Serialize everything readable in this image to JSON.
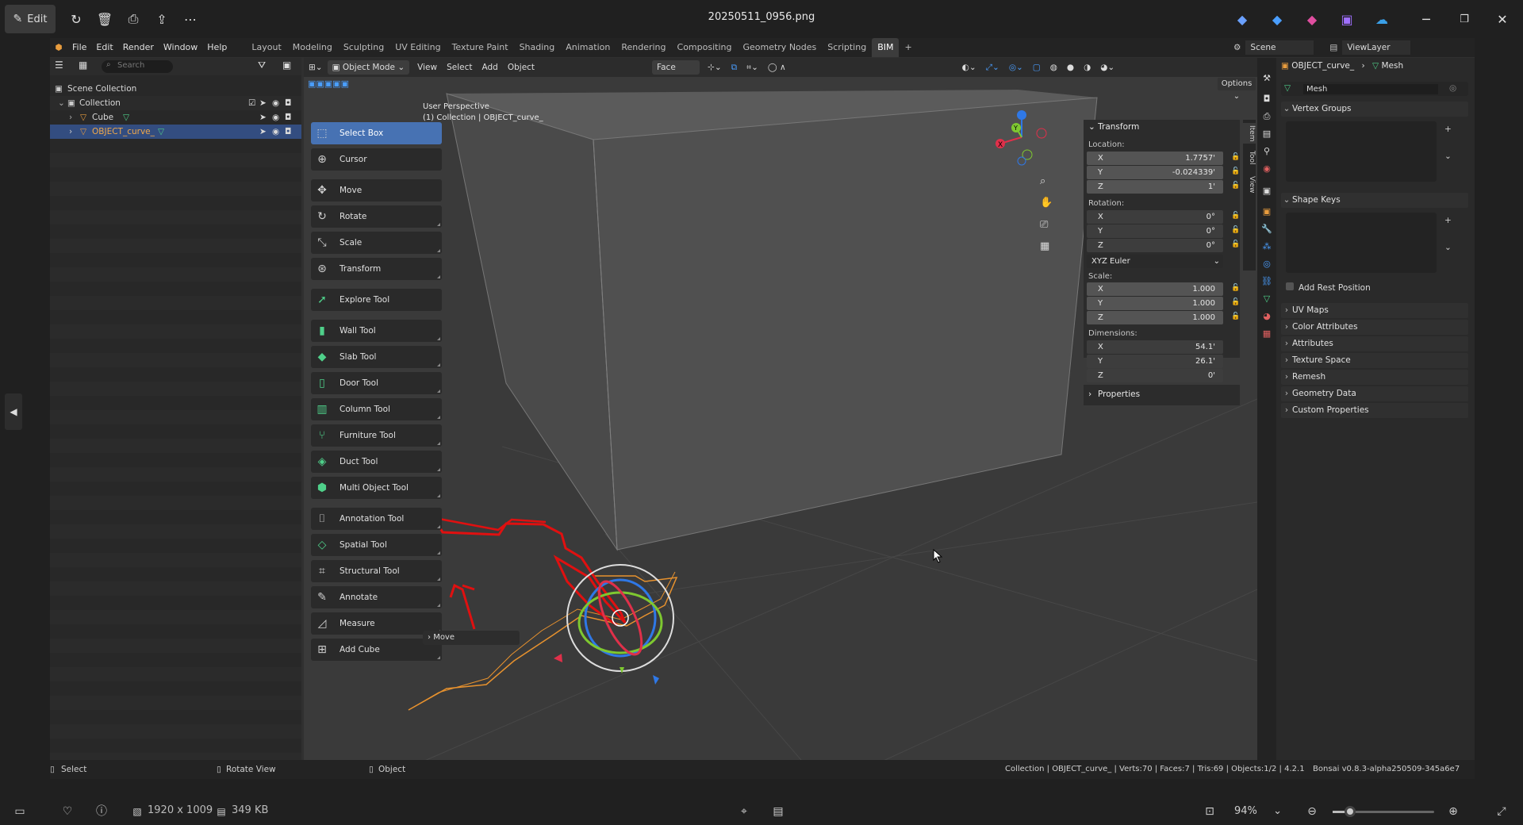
{
  "viewer": {
    "edit_label": "Edit",
    "filename": "20250511_0956.png",
    "dimensions": "1920 x 1009",
    "filesize": "349 KB",
    "zoom": "94%"
  },
  "menubar": {
    "menus": [
      "File",
      "Edit",
      "Render",
      "Window",
      "Help"
    ],
    "workspaces": [
      "Layout",
      "Modeling",
      "Sculpting",
      "UV Editing",
      "Texture Paint",
      "Shading",
      "Animation",
      "Rendering",
      "Compositing",
      "Geometry Nodes",
      "Scripting",
      "BIM"
    ],
    "active_workspace": "BIM",
    "scene": "Scene",
    "view_layer": "ViewLayer"
  },
  "outliner": {
    "search_placeholder": "Search",
    "rows": [
      {
        "label": "Scene Collection"
      },
      {
        "label": "Collection"
      },
      {
        "label": "Cube"
      },
      {
        "label": "OBJECT_curve_"
      }
    ]
  },
  "viewport": {
    "mode": "Object Mode",
    "menus": [
      "View",
      "Select",
      "Add",
      "Object"
    ],
    "snap_target": "Face",
    "options_label": "Options",
    "perspective": "User Perspective",
    "collection_info": "(1) Collection | OBJECT_curve_",
    "last_op": "Move"
  },
  "tools": [
    {
      "label": "Select Box",
      "icon": "select-box-icon",
      "selected": true
    },
    {
      "label": "Cursor",
      "icon": "cursor-icon"
    },
    {
      "label": "Move",
      "icon": "move-icon"
    },
    {
      "label": "Rotate",
      "icon": "rotate-icon"
    },
    {
      "label": "Scale",
      "icon": "scale-icon"
    },
    {
      "label": "Transform",
      "icon": "transform-icon"
    },
    {
      "label": "Explore Tool",
      "icon": "explore-icon"
    },
    {
      "label": "Wall Tool",
      "icon": "wall-icon"
    },
    {
      "label": "Slab Tool",
      "icon": "slab-icon"
    },
    {
      "label": "Door Tool",
      "icon": "door-icon"
    },
    {
      "label": "Column Tool",
      "icon": "column-icon"
    },
    {
      "label": "Furniture Tool",
      "icon": "furniture-icon"
    },
    {
      "label": "Duct Tool",
      "icon": "duct-icon"
    },
    {
      "label": "Multi Object Tool",
      "icon": "multi-object-icon"
    },
    {
      "label": "Annotation Tool",
      "icon": "annotation-icon"
    },
    {
      "label": "Spatial Tool",
      "icon": "spatial-icon"
    },
    {
      "label": "Structural Tool",
      "icon": "structural-icon"
    },
    {
      "label": "Annotate",
      "icon": "annotate-icon"
    },
    {
      "label": "Measure",
      "icon": "measure-icon"
    },
    {
      "label": "Add Cube",
      "icon": "add-cube-icon"
    }
  ],
  "transform": {
    "title": "Transform",
    "location_label": "Location:",
    "location": {
      "x": "1.7757'",
      "y": "-0.024339'",
      "z": "1'"
    },
    "rotation_label": "Rotation:",
    "rotation": {
      "x": "0°",
      "y": "0°",
      "z": "0°"
    },
    "rotation_mode": "XYZ Euler",
    "scale_label": "Scale:",
    "scale": {
      "x": "1.000",
      "y": "1.000",
      "z": "1.000"
    },
    "dimensions_label": "Dimensions:",
    "dimensions": {
      "x": "54.1'",
      "y": "26.1'",
      "z": "0'"
    },
    "properties_label": "Properties",
    "axis_x": "X",
    "axis_y": "Y",
    "axis_z": "Z"
  },
  "sidebar_tabs": [
    "Item",
    "Tool",
    "View"
  ],
  "properties": {
    "object_name": "OBJECT_curve_",
    "data_type": "Mesh",
    "mesh_name": "Mesh",
    "vertex_groups": "Vertex Groups",
    "shape_keys": "Shape Keys",
    "add_rest_position": "Add Rest Position",
    "sections": [
      "UV Maps",
      "Color Attributes",
      "Attributes",
      "Texture Space",
      "Remesh",
      "Geometry Data",
      "Custom Properties"
    ]
  },
  "statusbar": {
    "select": "Select",
    "rotate_view": "Rotate View",
    "object": "Object",
    "info": "Collection | OBJECT_curve_ | Verts:70 | Faces:7 | Tris:69 | Objects:1/2 | 4.2.1",
    "addon": "Bonsai v0.8.3-alpha250509-345a6e7"
  }
}
